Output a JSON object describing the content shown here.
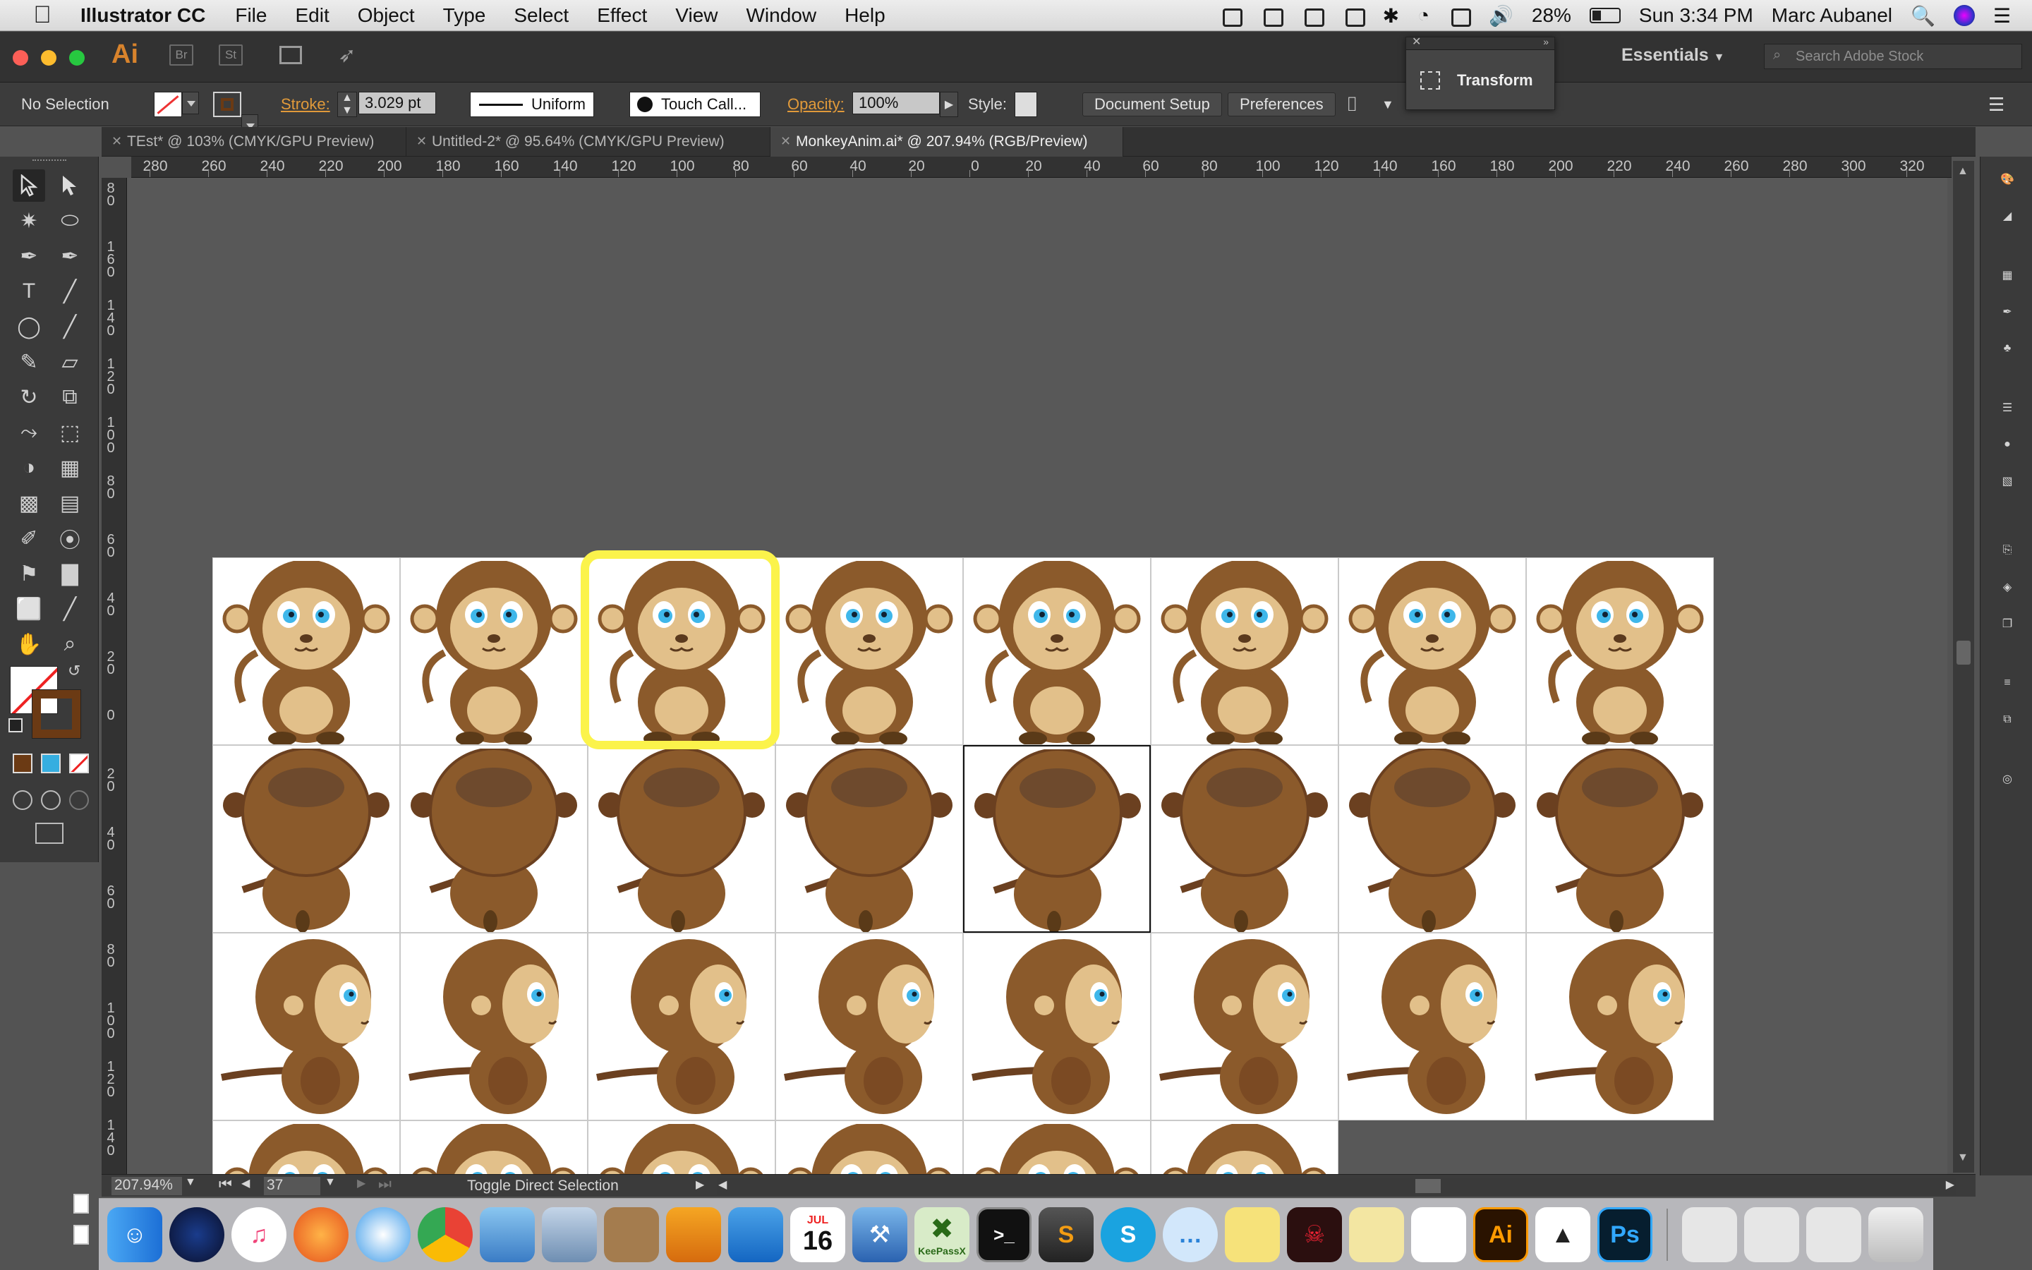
{
  "menubar": {
    "app_name": "Illustrator CC",
    "items": [
      "File",
      "Edit",
      "Object",
      "Type",
      "Select",
      "Effect",
      "View",
      "Window",
      "Help"
    ],
    "battery": "28%",
    "clock": "Sun 3:34 PM",
    "user": "Marc Aubanel"
  },
  "appbar": {
    "logo": "Ai",
    "bridge": "Br",
    "stock": "St",
    "workspace": "Essentials",
    "search_placeholder": "Search Adobe Stock"
  },
  "controlbar": {
    "selection": "No Selection",
    "stroke_label": "Stroke:",
    "stroke_value": "3.029 pt",
    "profile": "Uniform",
    "brush": "Touch Call...",
    "opacity_label": "Opacity:",
    "opacity_value": "100%",
    "style_label": "Style:",
    "document_setup": "Document Setup",
    "preferences": "Preferences"
  },
  "transform_panel": {
    "title": "Transform"
  },
  "tabs": [
    {
      "label": "TEst* @ 103% (CMYK/GPU Preview)",
      "active": false
    },
    {
      "label": "Untitled-2* @ 95.64% (CMYK/GPU Preview)",
      "active": false
    },
    {
      "label": "MonkeyAnim.ai* @ 207.94% (RGB/Preview)",
      "active": true
    }
  ],
  "hruler_ticks": [
    "280",
    "260",
    "240",
    "220",
    "200",
    "180",
    "160",
    "140",
    "120",
    "100",
    "80",
    "60",
    "40",
    "20",
    "0",
    "20",
    "40",
    "60",
    "80",
    "100",
    "120",
    "140",
    "160",
    "180",
    "200",
    "220",
    "240",
    "260",
    "280",
    "300",
    "320"
  ],
  "vruler_ticks": [
    "80",
    "160",
    "140",
    "120",
    "100",
    "80",
    "60",
    "40",
    "20",
    "0",
    "20",
    "40",
    "60",
    "80",
    "100",
    "120",
    "140"
  ],
  "statusbar": {
    "zoom": "207.94%",
    "artboard": "37",
    "tool_hint": "Toggle Direct Selection"
  },
  "colors": {
    "accent_orange": "#e19a3a",
    "highlight_yellow": "#fbf34b",
    "fur_dark": "#8b5a2b",
    "fur_light": "#e2c08a",
    "eye_blue": "#3fb7ea"
  },
  "sprites": {
    "rows": [
      {
        "pose": "front",
        "count": 8
      },
      {
        "pose": "back",
        "count": 8
      },
      {
        "pose": "side",
        "count": 8
      },
      {
        "pose": "front-partial",
        "count": 6
      }
    ],
    "selected_index": 2
  },
  "dock": {
    "calendar_month": "JUL",
    "calendar_day": "16",
    "ai": "Ai",
    "ps": "Ps",
    "keepass": "KeePassX"
  }
}
